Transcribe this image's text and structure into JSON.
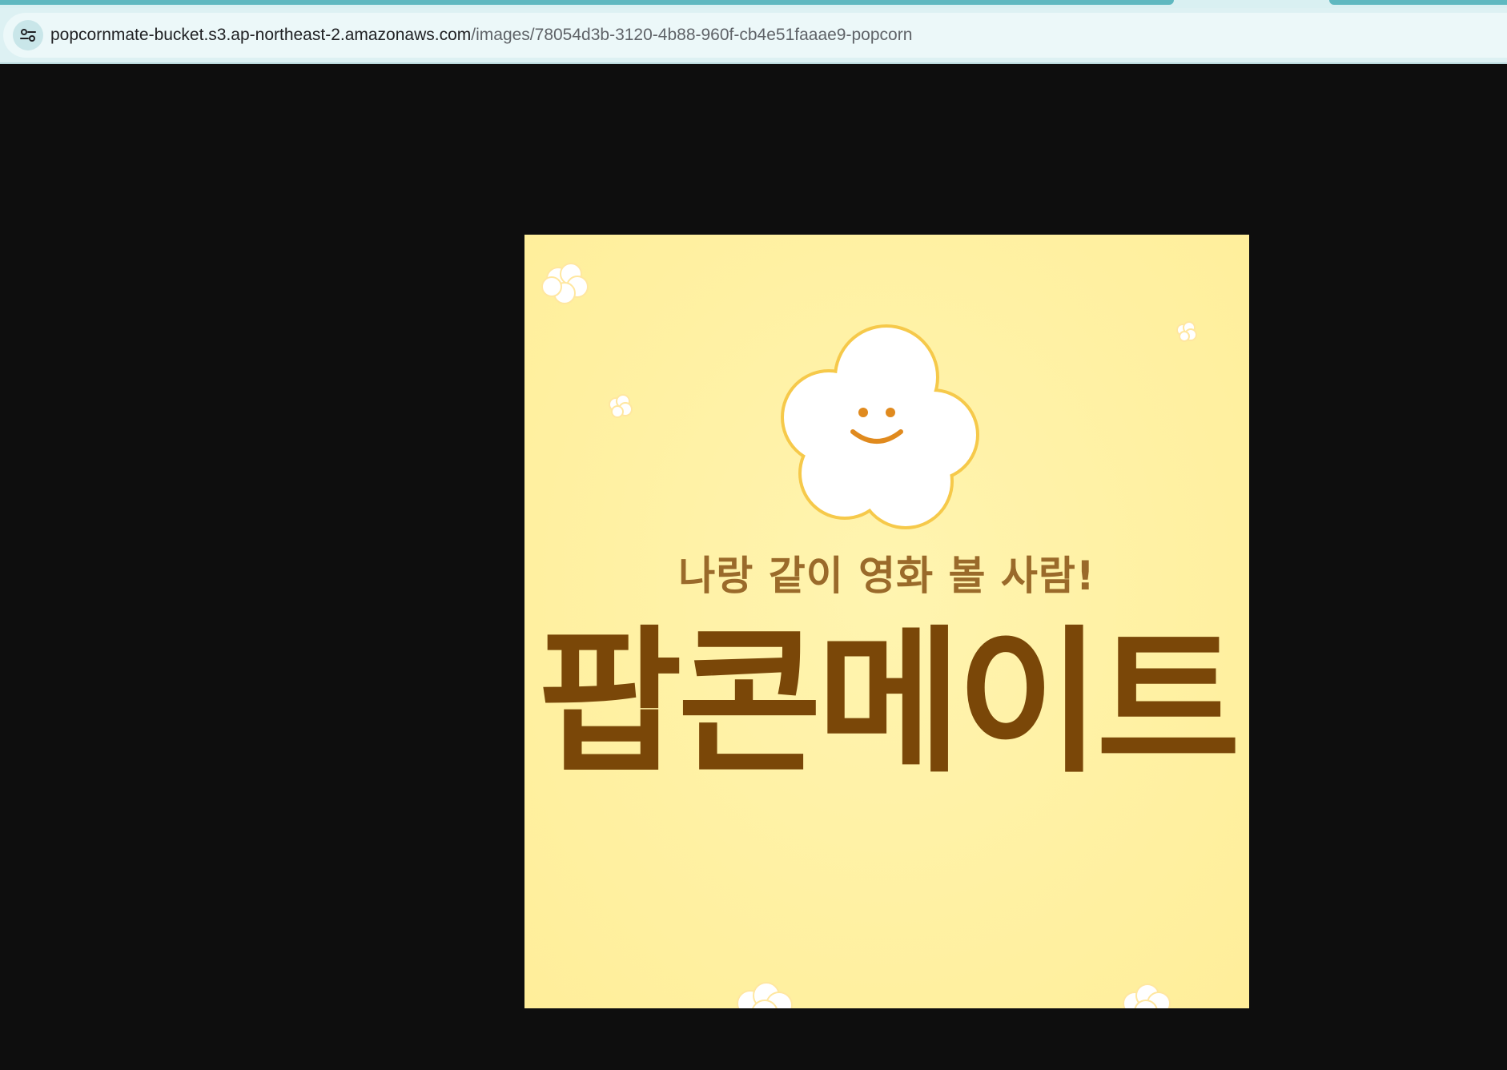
{
  "browser": {
    "url_host": "popcornmate-bucket.s3.ap-northeast-2.amazonaws.com",
    "url_path": "/images/78054d3b-3120-4b88-960f-cb4e51faaae9-popcorn",
    "site_info_icon": "tune-icon"
  },
  "image": {
    "subtitle": "나랑 같이 영화 볼 사람!",
    "brand": "팝콘메이트",
    "mascot_icon": "smiling-popcorn-icon",
    "colors": {
      "background": "#fff1a3",
      "brand_text": "#7a4708",
      "subtitle_text": "#9a6a2a",
      "popcorn_outline": "#f6c94a",
      "face": "#e08a1e"
    }
  }
}
